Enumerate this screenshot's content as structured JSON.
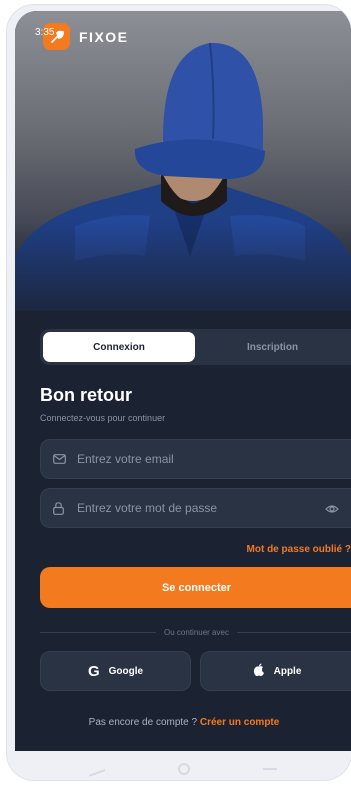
{
  "status_bar": {
    "time": "3:35"
  },
  "brand": {
    "name": "FIXOE",
    "accent": "#f47a20"
  },
  "auth": {
    "tabs": [
      {
        "label": "Connexion",
        "active": true
      },
      {
        "label": "Inscription",
        "active": false
      }
    ],
    "title": "Bon retour",
    "subtitle": "Connectez-vous pour continuer",
    "email": {
      "placeholder": "Entrez votre email",
      "value": "",
      "icon": "mail-icon"
    },
    "password": {
      "placeholder": "Entrez votre mot de passe",
      "value": "",
      "icon": "lock-icon",
      "toggle_icon": "eye-icon"
    },
    "forgot_label": "Mot de passe oublié ?",
    "submit_label": "Se connecter",
    "divider_label": "Ou continuer avec",
    "social": [
      {
        "label": "Google",
        "icon": "google-icon"
      },
      {
        "label": "Apple",
        "icon": "apple-icon"
      }
    ],
    "signup_prompt": "Pas encore de compte ?",
    "signup_link": "Créer un compte"
  },
  "colors": {
    "background": "#1b2333",
    "field": "#2a3344",
    "muted": "#8b93a5"
  }
}
